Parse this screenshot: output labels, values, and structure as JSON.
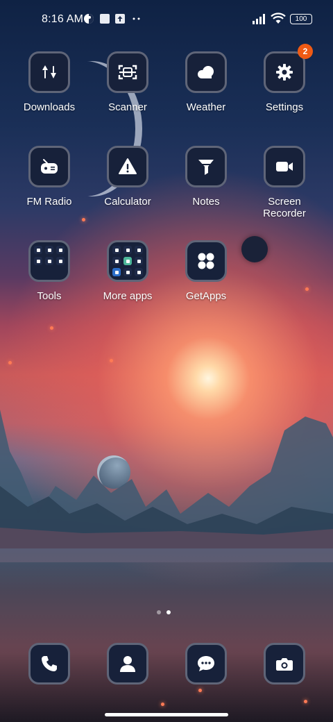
{
  "status_bar": {
    "time": "8:16 AM",
    "battery": "100",
    "notification_icons": [
      "motion-icon",
      "square-icon",
      "upload-icon",
      "more-dots-icon"
    ],
    "system_icons": [
      "signal-icon",
      "wifi-icon",
      "battery-icon"
    ]
  },
  "apps": [
    {
      "label": "Downloads",
      "icon": "downloads-icon"
    },
    {
      "label": "Scanner",
      "icon": "scanner-icon"
    },
    {
      "label": "Weather",
      "icon": "weather-icon"
    },
    {
      "label": "Settings",
      "icon": "gear-icon",
      "badge": "2"
    },
    {
      "label": "FM Radio",
      "icon": "radio-icon"
    },
    {
      "label": "Calculator",
      "icon": "warning-icon"
    },
    {
      "label": "Notes",
      "icon": "funnel-icon"
    },
    {
      "label": "Screen\nRecorder",
      "icon": "video-camera-icon"
    },
    {
      "label": "Tools",
      "icon": "folder-icon"
    },
    {
      "label": "More apps",
      "icon": "folder-icon"
    },
    {
      "label": "GetApps",
      "icon": "getapps-icon"
    }
  ],
  "page_indicator": {
    "pages": 2,
    "current": 2
  },
  "dock": [
    {
      "icon": "phone-icon"
    },
    {
      "icon": "contacts-icon"
    },
    {
      "icon": "messages-icon"
    },
    {
      "icon": "camera-icon"
    }
  ],
  "colors": {
    "icon_background": "#17213a",
    "icon_border": "#5f6578",
    "badge": "#ef5a14"
  }
}
